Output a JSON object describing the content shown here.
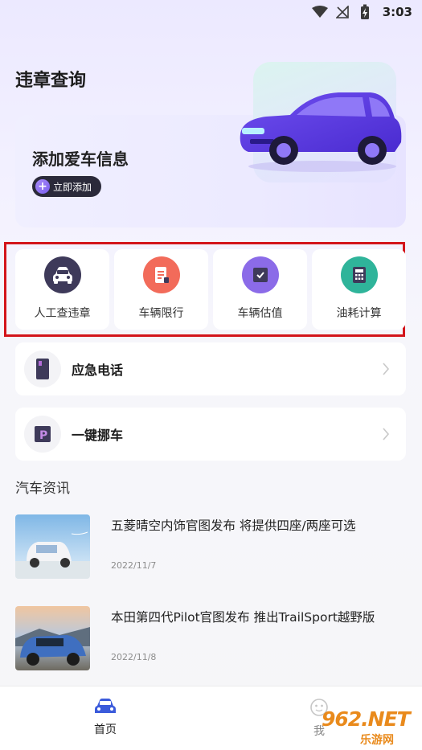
{
  "status_bar": {
    "time": "3:03",
    "icons": [
      "wifi-icon",
      "signal-off-icon",
      "battery-charging-icon"
    ]
  },
  "page": {
    "title": "违章查询"
  },
  "banner": {
    "title": "添加爱车信息",
    "button_label": "立即添加",
    "button_icon": "plus-icon"
  },
  "quick_actions": [
    {
      "label": "人工查违章",
      "icon": "car-front-icon",
      "color": "#3e3a5a"
    },
    {
      "label": "车辆限行",
      "icon": "document-icon",
      "color": "#f26b5a"
    },
    {
      "label": "车辆估值",
      "icon": "checkbox-icon",
      "color": "#8b6be8"
    },
    {
      "label": "油耗计算",
      "icon": "calculator-icon",
      "color": "#2fb49a"
    }
  ],
  "list_items": [
    {
      "label": "应急电话",
      "icon": "phone-icon"
    },
    {
      "label": "一键挪车",
      "icon": "parking-icon"
    }
  ],
  "news": {
    "section_title": "汽车资讯",
    "items": [
      {
        "title": "五菱晴空内饰官图发布 将提供四座/两座可选",
        "date": "2022/11/7"
      },
      {
        "title": "本田第四代Pilot官图发布 推出TrailSport越野版",
        "date": "2022/11/8"
      }
    ]
  },
  "bottom_nav": {
    "home_label": "首页",
    "mine_label": "我"
  },
  "watermark": {
    "text_big": "962.NET",
    "text_small": "乐游网"
  },
  "colors": {
    "highlight_border": "#d3151b",
    "accent": "#7b5ff0"
  }
}
